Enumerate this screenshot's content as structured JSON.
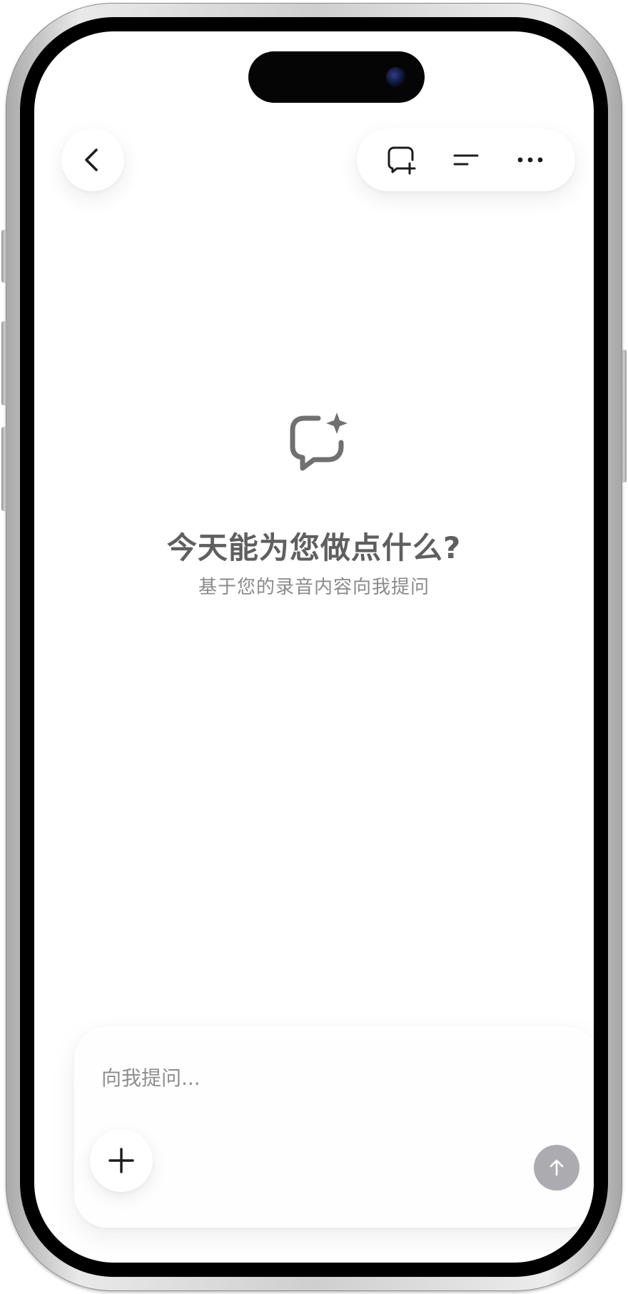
{
  "header": {
    "back_icon": "chevron-left-icon",
    "actions": [
      {
        "name": "new-chat-icon"
      },
      {
        "name": "menu-lines-icon"
      },
      {
        "name": "more-dots-icon"
      }
    ]
  },
  "empty_state": {
    "icon": "chat-sparkle-icon",
    "title": "今天能为您做点什么?",
    "subtitle": "基于您的录音内容向我提问"
  },
  "composer": {
    "placeholder": "向我提问...",
    "value": "",
    "add_icon": "plus-icon",
    "send_icon": "arrow-up-icon"
  },
  "colors": {
    "title": "#5f5f5f",
    "subtitle": "#8a8a8a",
    "send_disabled": "#acacb0",
    "icon_dark": "#1c1c1c",
    "icon_gray": "#707070"
  }
}
